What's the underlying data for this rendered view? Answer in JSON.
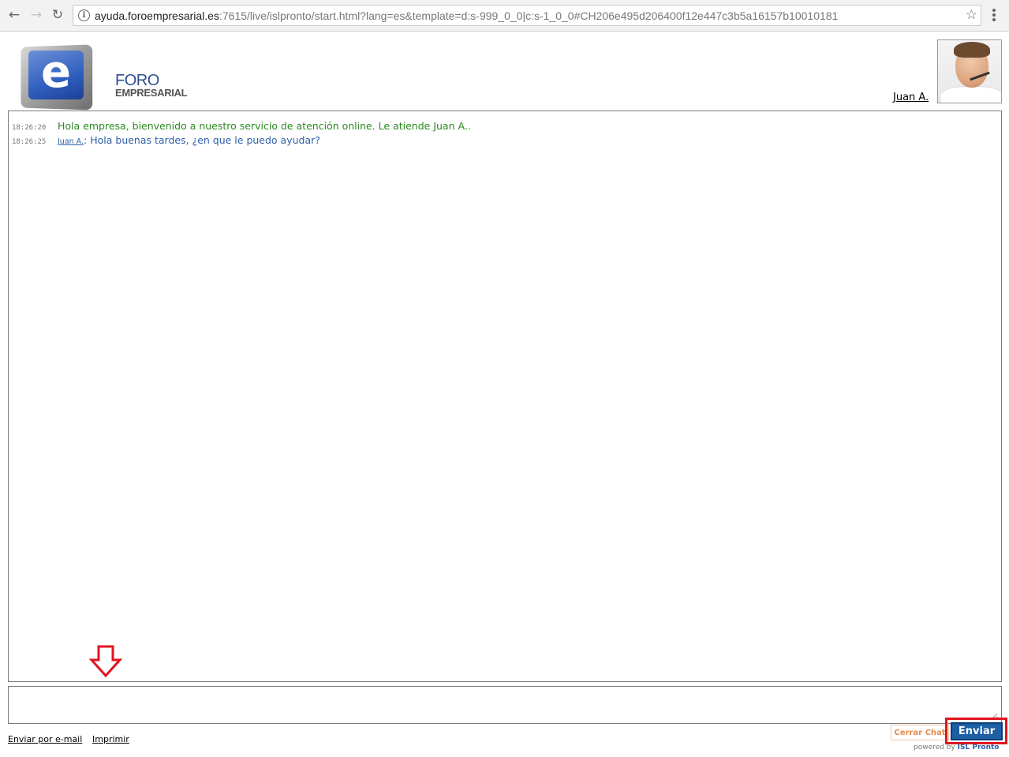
{
  "browser": {
    "url_host": "ayuda.foroempresarial.es",
    "url_rest": ":7615/live/islpronto/start.html?lang=es&template=d:s-999_0_0|c:s-1_0_0#CH206e495d206400f12e447c3b5a16157b10010181",
    "icons": {
      "back": "back-arrow-icon",
      "forward": "forward-arrow-icon",
      "reload": "reload-icon",
      "info": "info-icon",
      "bookmark": "star-icon",
      "menu": "kebab-menu-icon"
    }
  },
  "header": {
    "logo_letter": "e",
    "logo_title": "FORO",
    "logo_subtitle": "EMPRESARIAL",
    "agent_name": "Juan A.",
    "agent_photo": "agent-headset-photo"
  },
  "chat": {
    "messages": [
      {
        "time": "18:26:20",
        "sender": "",
        "text": "Hola empresa, bienvenido a nuestro servicio de atención online. Le atiende Juan A..",
        "type": "system"
      },
      {
        "time": "18:26:25",
        "sender": "Juan A.",
        "text": ": Hola buenas tardes, ¿en que le puedo ayudar?",
        "type": "agent"
      }
    ],
    "input_value": ""
  },
  "footer": {
    "email_link": "Enviar por e-mail",
    "print_link": "Imprimir",
    "close_label": "Cerrar Chat",
    "send_label": "Enviar",
    "powered_prefix": "powered by",
    "powered_brand": "ISL Pronto"
  },
  "colors": {
    "system_message": "#2a8a1e",
    "agent_message": "#2e5fa8",
    "send_button": "#1c5fa3",
    "annotation_red": "#e0151f",
    "close_chat": "#e8894a"
  }
}
